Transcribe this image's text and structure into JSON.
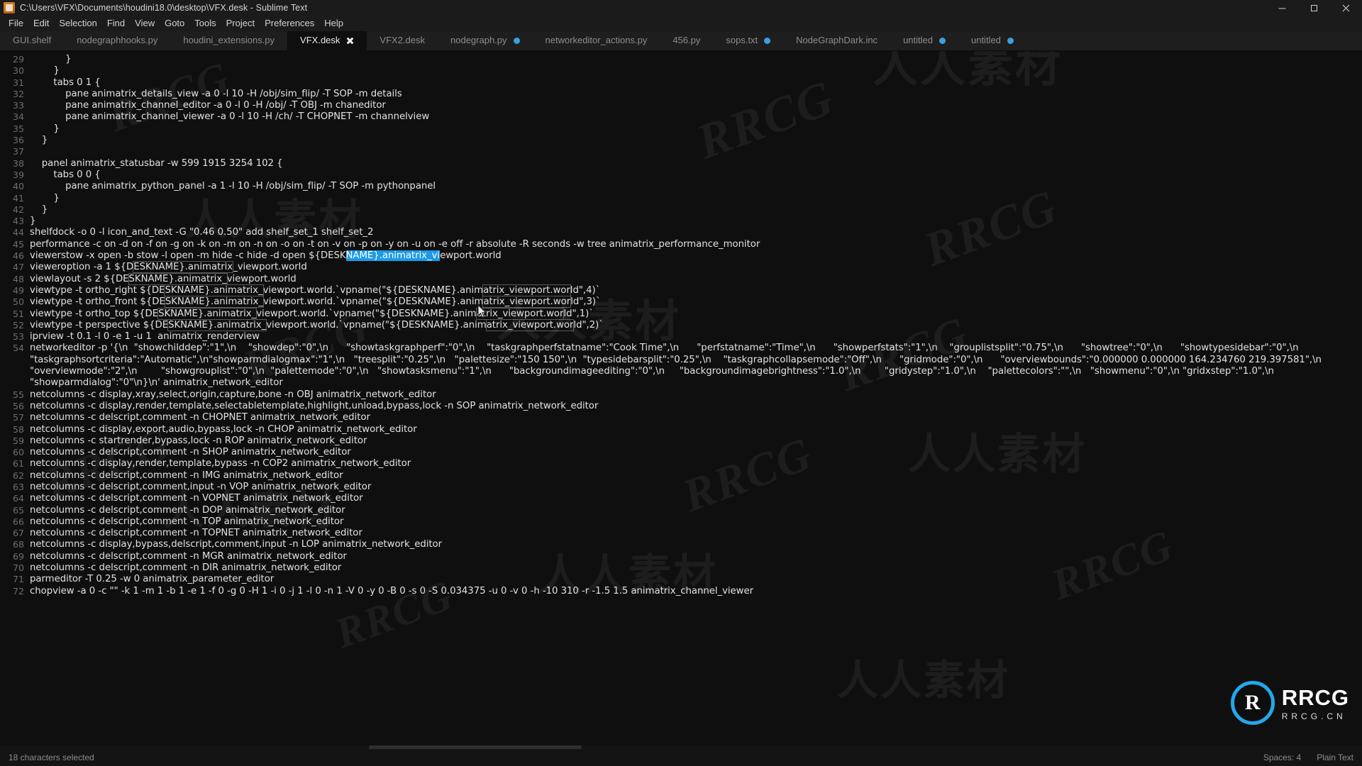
{
  "window": {
    "title": "C:\\Users\\VFX\\Documents\\houdini18.0\\desktop\\VFX.desk - Sublime Text",
    "app_icon": "sublime-text-icon",
    "minimize_label": "Minimize",
    "maximize_label": "Restore",
    "close_label": "Close"
  },
  "menubar": {
    "items": [
      {
        "label": "File"
      },
      {
        "label": "Edit"
      },
      {
        "label": "Selection"
      },
      {
        "label": "Find"
      },
      {
        "label": "View"
      },
      {
        "label": "Goto"
      },
      {
        "label": "Tools"
      },
      {
        "label": "Project"
      },
      {
        "label": "Preferences"
      },
      {
        "label": "Help"
      }
    ]
  },
  "tabs": [
    {
      "label": "GUI.shelf",
      "active": false,
      "dirty": false
    },
    {
      "label": "nodegraphhooks.py",
      "active": false,
      "dirty": false
    },
    {
      "label": "houdini_extensions.py",
      "active": false,
      "dirty": false
    },
    {
      "label": "VFX.desk",
      "active": true,
      "dirty": false,
      "close": true
    },
    {
      "label": "VFX2.desk",
      "active": false,
      "dirty": false
    },
    {
      "label": "nodegraph.py",
      "active": false,
      "dirty": true
    },
    {
      "label": "networkeditor_actions.py",
      "active": false,
      "dirty": false
    },
    {
      "label": "456.py",
      "active": false,
      "dirty": false
    },
    {
      "label": "sops.txt",
      "active": false,
      "dirty": true
    },
    {
      "label": "NodeGraphDark.inc",
      "active": false,
      "dirty": false
    },
    {
      "label": "untitled",
      "active": false,
      "dirty": true
    },
    {
      "label": "untitled",
      "active": false,
      "dirty": true
    }
  ],
  "editor": {
    "selection_color": "#1c9ae8",
    "selected_text": "animatrix_viewport",
    "lines": [
      {
        "n": "29",
        "text": "            }"
      },
      {
        "n": "30",
        "text": "        }"
      },
      {
        "n": "31",
        "text": "        tabs 0 1 {"
      },
      {
        "n": "32",
        "text": "            pane animatrix_details_view -a 0 -l 10 -H /obj/sim_flip/ -T SOP -m details"
      },
      {
        "n": "33",
        "text": "            pane animatrix_channel_editor -a 0 -l 0 -H /obj/ -T OBJ -m chaneditor"
      },
      {
        "n": "34",
        "text": "            pane animatrix_channel_viewer -a 0 -l 10 -H /ch/ -T CHOPNET -m channelview"
      },
      {
        "n": "35",
        "text": "        }"
      },
      {
        "n": "36",
        "text": "    }"
      },
      {
        "n": "37",
        "text": ""
      },
      {
        "n": "38",
        "text": "    panel animatrix_statusbar -w 599 1915 3254 102 {"
      },
      {
        "n": "39",
        "text": "        tabs 0 0 {"
      },
      {
        "n": "40",
        "text": "            pane animatrix_python_panel -a 1 -l 10 -H /obj/sim_flip/ -T SOP -m pythonpanel"
      },
      {
        "n": "41",
        "text": "        }"
      },
      {
        "n": "42",
        "text": "    }"
      },
      {
        "n": "43",
        "text": "}"
      },
      {
        "n": "44",
        "text": "shelfdock -o 0 -l icon_and_text -G \"0.46 0.50\" add shelf_set_1 shelf_set_2"
      },
      {
        "n": "45",
        "text": "performance -c on -d on -f on -g on -k on -m on -n on -o on -t on -v on -p on -y on -u on -e off -r absolute -R seconds -w tree animatrix_performance_monitor"
      },
      {
        "n": "46",
        "text": "viewerstow -x open -b stow -l open -m hide -c hide -d open ${DESKNAME}.animatrix_viewport.world",
        "selection": {
          "start": 65,
          "end": 83
        }
      },
      {
        "n": "47",
        "text": "vieweroption -a 1 ${DESKNAME}.animatrix_viewport.world",
        "occurrences": [
          [
            21,
            39
          ]
        ]
      },
      {
        "n": "48",
        "text": "viewlayout -s 2 ${DESKNAME}.animatrix_viewport.world",
        "occurrences": [
          [
            20,
            38
          ]
        ]
      },
      {
        "n": "49",
        "text": "viewtype -t ortho_right ${DESKNAME}.animatrix_viewport.world.`vpname(\"${DESKNAME}.animatrix_viewport.world\",4)`",
        "occurrences": [
          [
            28,
            46
          ],
          [
            86,
            104
          ]
        ]
      },
      {
        "n": "50",
        "text": "viewtype -t ortho_front ${DESKNAME}.animatrix_viewport.world.`vpname(\"${DESKNAME}.animatrix_viewport.world\",3)`",
        "occurrences": [
          [
            28,
            46
          ],
          [
            86,
            104
          ]
        ]
      },
      {
        "n": "51",
        "text": "viewtype -t ortho_top ${DESKNAME}.animatrix_viewport.world.`vpname(\"${DESKNAME}.animatrix_viewport.world\",1)`",
        "occurrences": [
          [
            26,
            44
          ],
          [
            84,
            102
          ]
        ]
      },
      {
        "n": "52",
        "text": "viewtype -t perspective ${DESKNAME}.animatrix_viewport.world.`vpname(\"${DESKNAME}.animatrix_viewport.world\",2)`",
        "occurrences": [
          [
            28,
            46
          ],
          [
            86,
            104
          ]
        ]
      },
      {
        "n": "53",
        "text": "iprview -t 0.1 -l 0 -e 1 -u 1  animatrix_renderview"
      },
      {
        "n": "54",
        "text": "networkeditor -p '{\\n  \"showchilddep\":\"1\",\\n    \"showdep\":\"0\",\\n      \"showtaskgraphperf\":\"0\",\\n    \"taskgraphperfstatname\":\"Cook Time\",\\n      \"perfstatname\":\"Time\",\\n      \"showperfstats\":\"1\",\\n    \"grouplistsplit\":\"0.75\",\\n      \"showtree\":\"0\",\\n      \"showtypesidebar\":\"0\",\\n      \"taskgraphsortcriteria\":\"Automatic\",\\n\"showparmdialogmax\":\"1\",\\n   \"treesplit\":\"0.25\",\\n   \"palettesize\":\"150 150\",\\n  \"typesidebarsplit\":\"0.25\",\\n    \"taskgraphcollapsemode\":\"Off\",\\n      \"gridmode\":\"0\",\\n      \"overviewbounds\":\"0.000000 0.000000 164.234760 219.397581\",\\n \"overviewmode\":\"2\",\\n        \"showgrouplist\":\"0\",\\n  \"palettemode\":\"0\",\\n   \"showtasksmenu\":\"1\",\\n      \"backgroundimageediting\":\"0\",\\n     \"backgroundimagebrightness\":\"1.0\",\\n        \"gridystep\":\"1.0\",\\n    \"palettecolors\":\"\",\\n   \"showmenu\":\"0\",\\n \"gridxstep\":\"1.0\",\\n    \"showparmdialog\":\"0\"\\n}\\n' animatrix_network_editor"
      },
      {
        "n": "55",
        "text": "netcolumns -c display,xray,select,origin,capture,bone -n OBJ animatrix_network_editor"
      },
      {
        "n": "56",
        "text": "netcolumns -c display,render,template,selectabletemplate,highlight,unload,bypass,lock -n SOP animatrix_network_editor"
      },
      {
        "n": "57",
        "text": "netcolumns -c delscript,comment -n CHOPNET animatrix_network_editor"
      },
      {
        "n": "58",
        "text": "netcolumns -c display,export,audio,bypass,lock -n CHOP animatrix_network_editor"
      },
      {
        "n": "59",
        "text": "netcolumns -c startrender,bypass,lock -n ROP animatrix_network_editor"
      },
      {
        "n": "60",
        "text": "netcolumns -c delscript,comment -n SHOP animatrix_network_editor"
      },
      {
        "n": "61",
        "text": "netcolumns -c display,render,template,bypass -n COP2 animatrix_network_editor"
      },
      {
        "n": "62",
        "text": "netcolumns -c delscript,comment -n IMG animatrix_network_editor"
      },
      {
        "n": "63",
        "text": "netcolumns -c delscript,comment,input -n VOP animatrix_network_editor"
      },
      {
        "n": "64",
        "text": "netcolumns -c delscript,comment -n VOPNET animatrix_network_editor"
      },
      {
        "n": "65",
        "text": "netcolumns -c delscript,comment -n DOP animatrix_network_editor"
      },
      {
        "n": "66",
        "text": "netcolumns -c delscript,comment -n TOP animatrix_network_editor"
      },
      {
        "n": "67",
        "text": "netcolumns -c delscript,comment -n TOPNET animatrix_network_editor"
      },
      {
        "n": "68",
        "text": "netcolumns -c display,bypass,delscript,comment,input -n LOP animatrix_network_editor"
      },
      {
        "n": "69",
        "text": "netcolumns -c delscript,comment -n MGR animatrix_network_editor"
      },
      {
        "n": "70",
        "text": "netcolumns -c delscript,comment -n DIR animatrix_network_editor"
      },
      {
        "n": "71",
        "text": "parmeditor -T 0.25 -w 0 animatrix_parameter_editor"
      },
      {
        "n": "72",
        "text": "chopview -a 0 -c \"\" -k 1 -m 1 -b 1 -e 1 -f 0 -g 0 -H 1 -i 0 -j 1 -l 0 -n 1 -V 0 -y 0 -B 0 -s 0 -S 0.034375 -u 0 -v 0 -h -10 310 -r -1.5 1.5 animatrix_channel_viewer"
      }
    ]
  },
  "statusbar": {
    "left": "18 characters selected",
    "indent": "Spaces: 4",
    "syntax": "Plain Text"
  },
  "watermarks": {
    "chinese": "人人素材",
    "latin": "RRCG",
    "logo_text": "RRCG",
    "logo_sub": "RRCG.CN",
    "logo_mark": "R"
  }
}
